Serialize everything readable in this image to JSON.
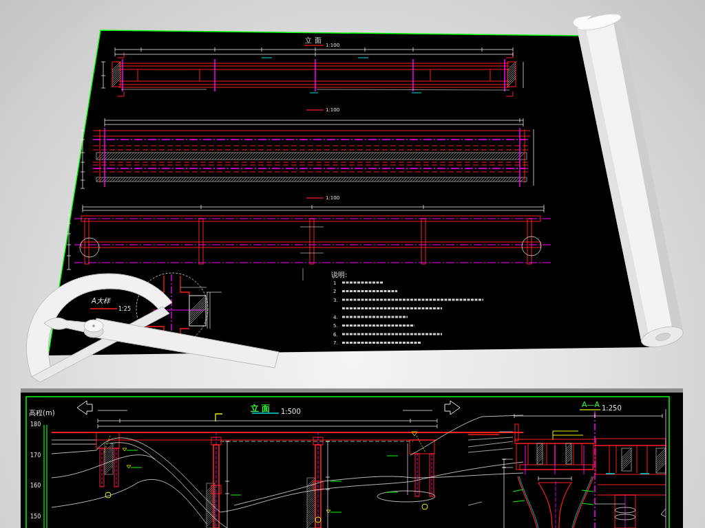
{
  "top_sheet": {
    "elevation_view": {
      "title": "立 面",
      "scale": "1:100"
    },
    "plan_view": {
      "scale": "1:100"
    },
    "frame_view": {
      "scale": "1:100"
    },
    "detail_a": {
      "title": "A大样",
      "scale": "1:25"
    },
    "notes": {
      "heading": "说明:",
      "numbers": [
        "1",
        "2",
        "3.",
        "4.",
        "5.",
        "6.",
        "7."
      ]
    }
  },
  "bottom_sheet": {
    "elevation": {
      "title": "立 面",
      "scale": "1:500",
      "axis_label": "高程(m)",
      "axis_ticks": [
        "180",
        "170",
        "160",
        "150"
      ]
    },
    "section": {
      "title": "A—A",
      "scale": "1:250"
    }
  }
}
